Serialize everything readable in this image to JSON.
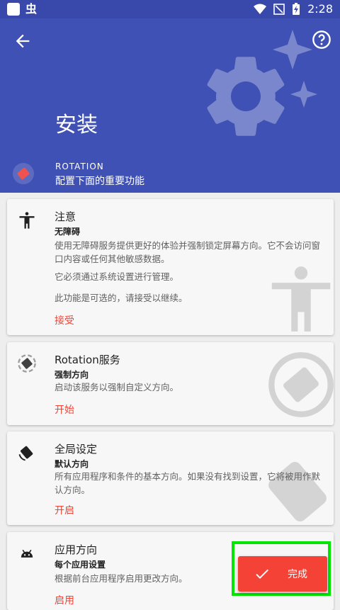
{
  "status_bar": {
    "app_glyph": "虫",
    "time": "2:28"
  },
  "header": {
    "title": "安装",
    "label": "ROTATION",
    "subtitle": "配置下面的重要功能",
    "icons": [
      "back-arrow-icon",
      "help-icon",
      "gear-icon",
      "sparkle-icon",
      "rotation-app-icon"
    ]
  },
  "cards": [
    {
      "title": "注意",
      "subtitle": "无障碍",
      "text1": "使用无障碍服务提供更好的体验并强制锁定屏幕方向。它不会访问窗口内容或任何其他敏感数据。",
      "text2": "它必须通过系统设置进行管理。",
      "text3": "此功能是可选的，请接受以继续。",
      "action": "接受",
      "icon": "accessibility-icon"
    },
    {
      "title": "Rotation服务",
      "subtitle": "强制方向",
      "text": "启动该服务以强制自定义方向。",
      "action": "开始",
      "icon": "rotation-service-icon"
    },
    {
      "title": "全局设定",
      "subtitle": "默认方向",
      "text": "所有应用程序和条件的基本方向。如果没有找到设置，它将被用作默认方向。",
      "action": "开启",
      "icon": "screen-rotation-icon"
    },
    {
      "title": "应用方向",
      "subtitle": "每个应用设置",
      "text": "根据前台应用程序启用更改方向。",
      "action": "启用",
      "icon": "android-icon"
    }
  ],
  "fab": {
    "label": "完成",
    "icon": "check-icon"
  },
  "colors": {
    "primary": "#3f51b5",
    "primary_dark": "#3949ab",
    "accent": "#f44336",
    "highlight": "#00e600"
  }
}
